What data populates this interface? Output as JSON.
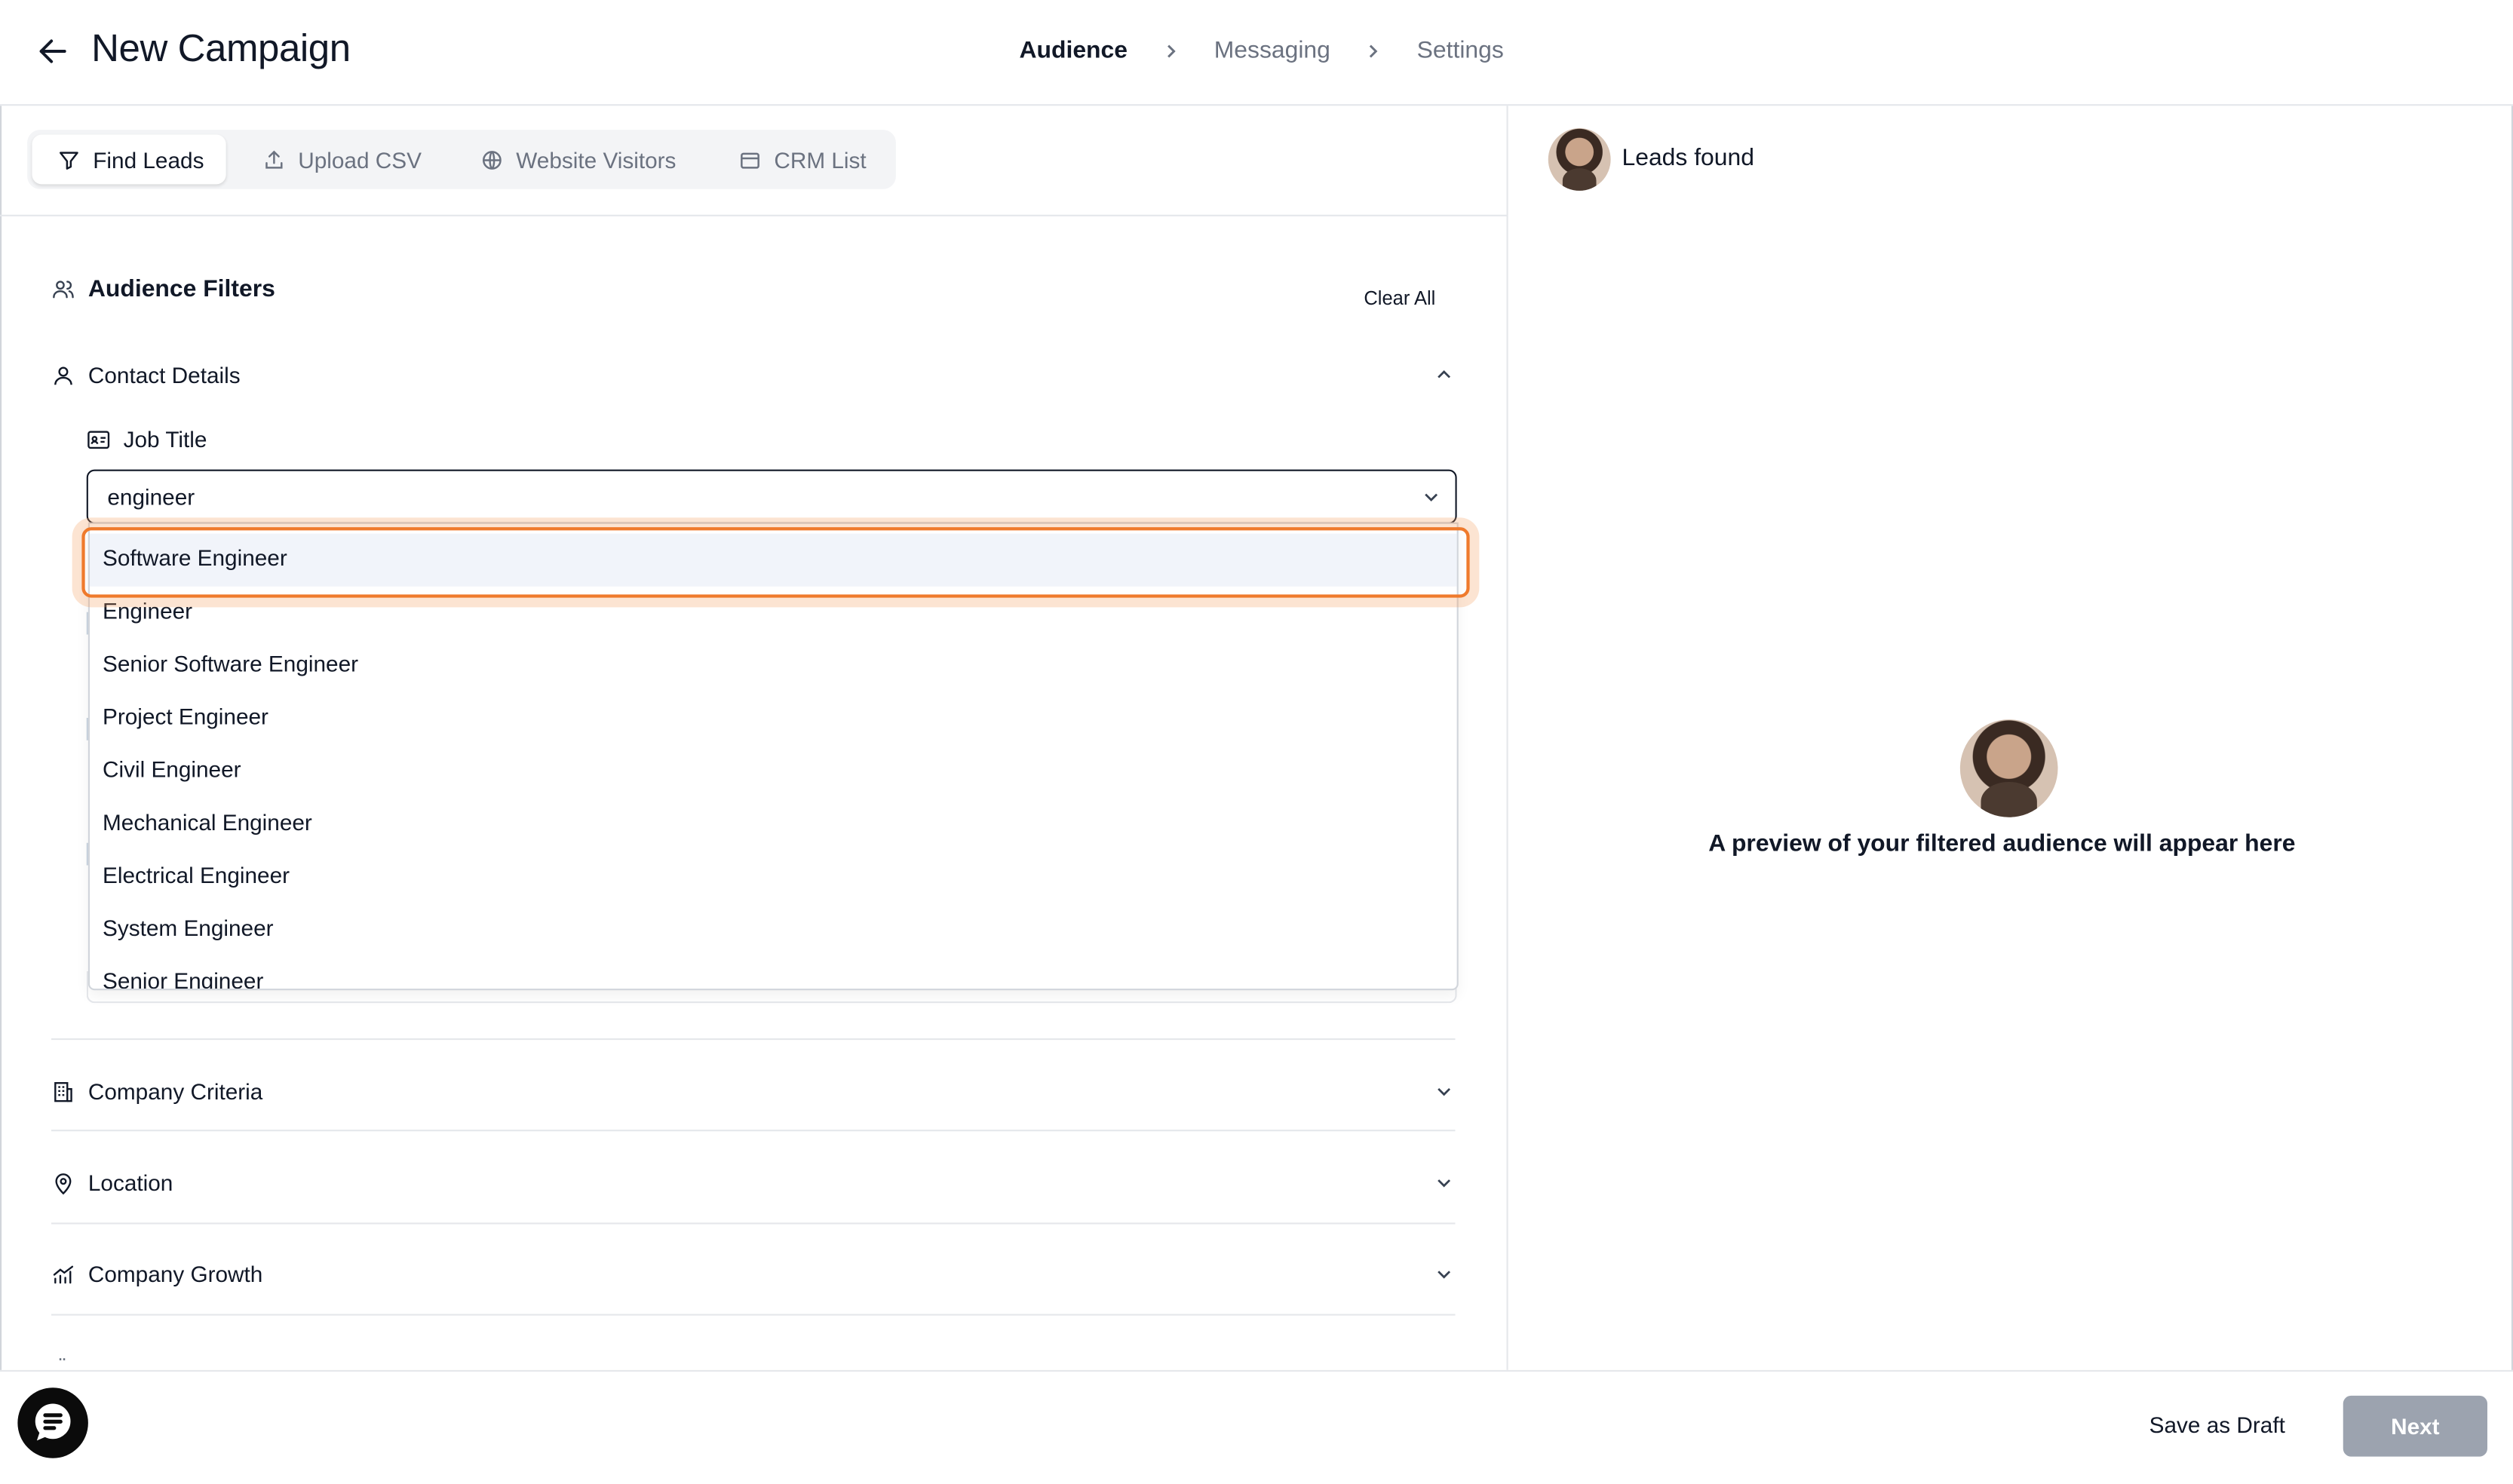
{
  "header": {
    "title": "New Campaign",
    "steps": [
      "Audience",
      "Messaging",
      "Settings"
    ],
    "active_step": "Audience"
  },
  "source_tabs": [
    "Find Leads",
    "Upload CSV",
    "Website Visitors",
    "CRM List"
  ],
  "filters": {
    "heading": "Audience Filters",
    "clear_all": "Clear All",
    "contact_section": "Contact Details",
    "job_title_label": "Job Title",
    "job_title_value": "engineer",
    "job_title_options": [
      "Software Engineer",
      "Engineer",
      "Senior Software Engineer",
      "Project Engineer",
      "Civil Engineer",
      "Mechanical Engineer",
      "Electrical Engineer",
      "System Engineer",
      "Senior Engineer"
    ],
    "sections": [
      "Company Criteria",
      "Location",
      "Company Growth"
    ],
    "more": ".."
  },
  "preview": {
    "leads_found": "Leads found",
    "message": "A preview of your filtered audience will appear here"
  },
  "footer": {
    "save_draft": "Save as Draft",
    "next": "Next"
  },
  "colors": {
    "highlight": "#ef7a2c",
    "next_disabled": "#9ca3af"
  }
}
